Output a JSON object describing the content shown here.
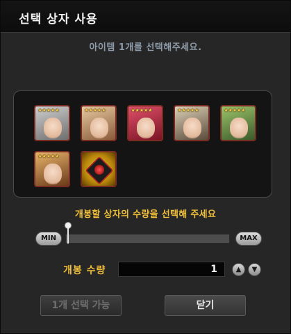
{
  "dialog": {
    "title": "선택 상자 사용",
    "instruction": "아이템 1개를 선택해주세요."
  },
  "items": [
    {
      "stars": "★★★★★",
      "theme": "white-hair-character",
      "colors": [
        "#cfcfcf",
        "#6e6e6e"
      ]
    },
    {
      "stars": "★★★★★",
      "theme": "blonde-character",
      "colors": [
        "#e6c9a0",
        "#8a5a3a"
      ]
    },
    {
      "stars": "★★★★★",
      "theme": "red-hair-character",
      "colors": [
        "#e0506a",
        "#7a1424"
      ]
    },
    {
      "stars": "★★★★★",
      "theme": "pale-blonde-character",
      "colors": [
        "#dcd0b6",
        "#5a4a3a"
      ]
    },
    {
      "stars": "★★★★★",
      "theme": "green-hair-character",
      "colors": [
        "#9cc46a",
        "#3a5a2a"
      ]
    },
    {
      "stars": "★★★★★",
      "theme": "tan-blonde-character",
      "colors": [
        "#e8b46a",
        "#6a3a1a"
      ]
    },
    {
      "stars": "",
      "theme": "red-cube-item",
      "colors": [
        "#e7c23a",
        "#1a1a1a"
      ]
    }
  ],
  "quantity": {
    "prompt": "개봉할 상자의 수량을 선택해 주세요",
    "min_label": "MIN",
    "max_label": "MAX",
    "slider_fraction": 0.0,
    "label": "개봉 수량",
    "value": "1",
    "up_icon": "chevron-up-icon",
    "down_icon": "chevron-down-icon"
  },
  "actions": {
    "select_label": "1개 선택 가능",
    "close_label": "닫기"
  }
}
